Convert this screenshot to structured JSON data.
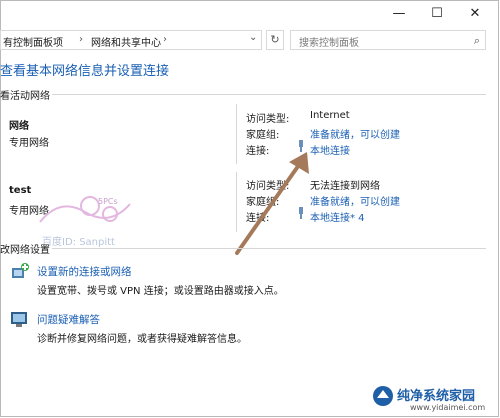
{
  "window": {
    "minimize_glyph": "—",
    "maximize_glyph": "☐",
    "close_glyph": "✕"
  },
  "address_bar": {
    "crumb_1": "有控制面板项",
    "crumb_2": "网络和共享中心",
    "separator": "›",
    "dropdown_glyph": "⌄",
    "refresh_glyph": "↻"
  },
  "search": {
    "placeholder": "搜索控制面板",
    "icon": "search-icon"
  },
  "page": {
    "title": "查看基本网络信息并设置连接",
    "active_networks_header": "看活动网络"
  },
  "networks": [
    {
      "name": "网络",
      "type": "专用网络",
      "access_type_label": "访问类型:",
      "access_type_value": "Internet",
      "homegroup_label": "家庭组:",
      "homegroup_value": "准备就绪，可以创建",
      "connection_label": "连接:",
      "connection_value": "本地连接"
    },
    {
      "name": "test",
      "type": "专用网络",
      "access_type_label": "访问类型:",
      "access_type_value": "无法连接到网络",
      "homegroup_label": "家庭组:",
      "homegroup_value": "准备就绪，可以创建",
      "connection_label": "连接:",
      "connection_value": "本地连接* 4"
    }
  ],
  "change_settings": {
    "header": "改网络设置",
    "items": [
      {
        "title": "设置新的连接或网络",
        "desc": "设置宽带、拨号或 VPN 连接；或设置路由器或接入点。",
        "icon": "network-setup-icon"
      },
      {
        "title": "问题疑难解答",
        "desc": "诊断并修复网络问题，或者获得疑难解答信息。",
        "icon": "troubleshoot-icon"
      }
    ]
  },
  "watermark": {
    "text": "百度ID: Sanpitt",
    "logo_text": "5PCs"
  },
  "site_badge": {
    "name": "纯净系统家园",
    "url": "www.yidaimei.com"
  },
  "colors": {
    "link": "#1a5fb4",
    "arrow": "#a57a5a"
  }
}
